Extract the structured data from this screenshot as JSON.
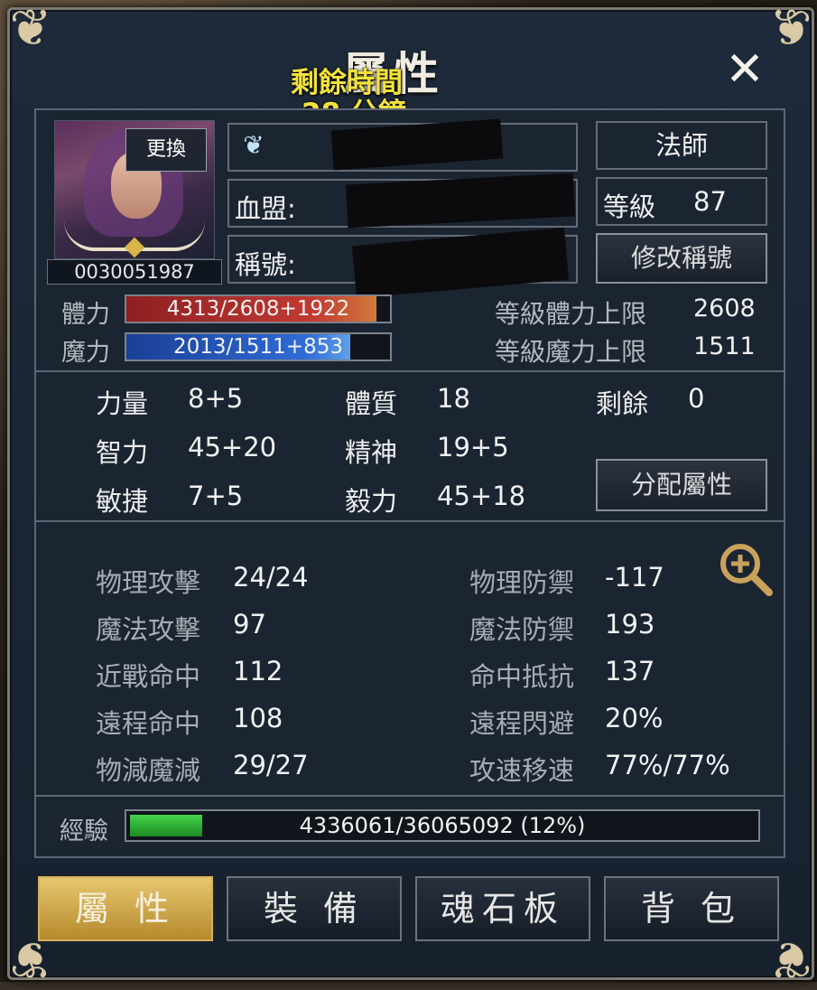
{
  "window": {
    "title": "屬性",
    "timer_line1": "剩餘時間",
    "timer_line2": "28 分鐘",
    "close_icon": "close-icon"
  },
  "character": {
    "change_button": "更換",
    "id": "0030051987",
    "class_name": "法師",
    "level_label": "等級",
    "level_value": "87",
    "clan_label": "血盟:",
    "title_label": "稱號:",
    "edit_title_button": "修改稱號"
  },
  "bars": {
    "hp_label": "體力",
    "hp_text": "4313/2608+1922",
    "hp_fill": 0.95,
    "mp_label": "魔力",
    "mp_text": "2013/1511+853",
    "mp_fill": 0.85,
    "hp_limit_label": "等級體力上限",
    "hp_limit_value": "2608",
    "mp_limit_label": "等級魔力上限",
    "mp_limit_value": "1511"
  },
  "base_stats": {
    "str_label": "力量",
    "str_value": "8+5",
    "con_label": "體質",
    "con_value": "18",
    "remain_label": "剩餘",
    "remain_value": "0",
    "int_label": "智力",
    "int_value": "45+20",
    "wis_label": "精神",
    "wis_value": "19+5",
    "dex_label": "敏捷",
    "dex_value": "7+5",
    "will_label": "毅力",
    "will_value": "45+18",
    "allocate_button": "分配屬性"
  },
  "combat_stats": {
    "patk_label": "物理攻擊",
    "patk_value": "24/24",
    "pdef_label": "物理防禦",
    "pdef_value": "-117",
    "matk_label": "魔法攻擊",
    "matk_value": "97",
    "mdef_label": "魔法防禦",
    "mdef_value": "193",
    "melee_hit_label": "近戰命中",
    "melee_hit_value": "112",
    "hit_resist_label": "命中抵抗",
    "hit_resist_value": "137",
    "ranged_hit_label": "遠程命中",
    "ranged_hit_value": "108",
    "ranged_evade_label": "遠程閃避",
    "ranged_evade_value": "20%",
    "dmg_red_label": "物減魔減",
    "dmg_red_value": "29/27",
    "speed_label": "攻速移速",
    "speed_value": "77%/77%"
  },
  "experience": {
    "label": "經驗",
    "text": "4336061/36065092 (12%)",
    "fill": 0.12
  },
  "tabs": [
    {
      "label": "屬 性",
      "active": true
    },
    {
      "label": "裝 備",
      "active": false
    },
    {
      "label": "魂石板",
      "active": false
    },
    {
      "label": "背 包",
      "active": false
    }
  ],
  "colors": {
    "hp_bar": "#b52b2b",
    "mp_bar": "#2d63c8",
    "exp_bar": "#2fb33a",
    "timer_text": "#f2e23c",
    "active_tab": "#c9a24a"
  }
}
